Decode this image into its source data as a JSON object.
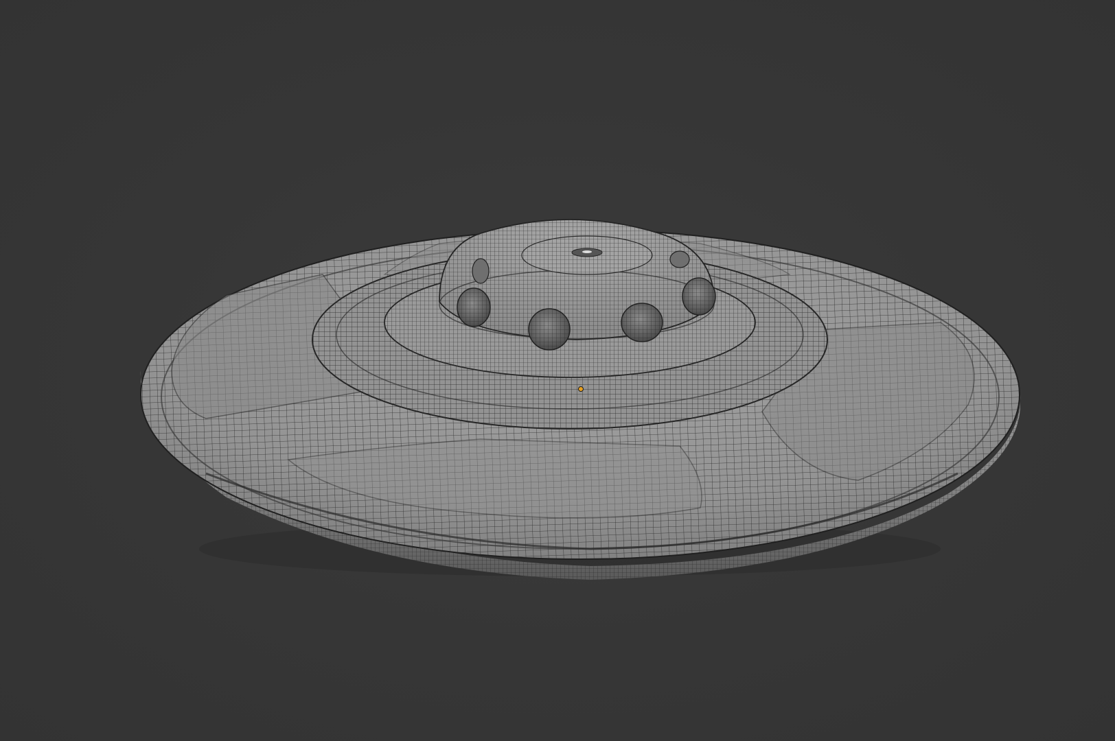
{
  "viewport": {
    "background_color": "#363636",
    "object_name": "",
    "shading": "solid-wireframe"
  },
  "model": {
    "description_icon": "ufo-mesh-icon",
    "portholes_visible": 6,
    "origin_marker_color": "#e8a020",
    "surface_color": "#8f8f8f",
    "wire_color": "#1e1e1e"
  }
}
